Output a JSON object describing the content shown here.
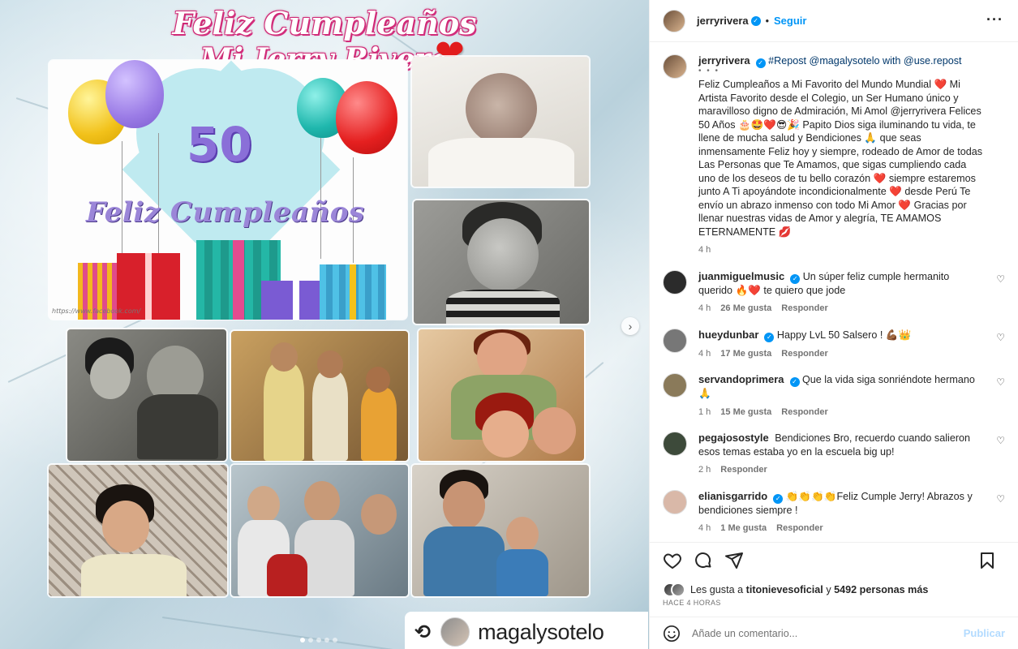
{
  "media": {
    "banner_line1": "Feliz Cumpleaños",
    "banner_line2": "Mi Jerry Rivera",
    "banner_heart": "❤",
    "card_number": "50",
    "card_greeting": "Feliz Cumpleaños",
    "repost_icon": "⟲",
    "repost_user": "magalysotelo",
    "next_arrow": "›"
  },
  "header": {
    "username": "jerryrivera",
    "verified": "✓",
    "dot": "•",
    "follow": "Seguir",
    "more": "···"
  },
  "caption": {
    "username": "jerryrivera",
    "repost_dots": "• • •",
    "prefix": "#Repost @magalysotelo with @use.repost",
    "text": "Feliz Cumpleaños a Mi Favorito del Mundo Mundial ❤️ Mi Artista Favorito desde el Colegio, un Ser Humano único y maravilloso digno de Admiración, Mi Amol @jerryrivera Felices 50 Años 🎂🤩❤️😎🎉 Papito Dios siga iluminando tu vida, te llene de mucha salud y Bendiciones 🙏 que seas inmensamente Feliz hoy y siempre, rodeado de Amor de todas Las Personas que Te Amamos, que sigas cumpliendo cada uno de los deseos de tu bello corazón ❤️ siempre estaremos junto A Ti apoyándote incondicionalmente ❤️ desde Perú Te envío un abrazo inmenso con todo Mi Amor ❤️ Gracias por llenar nuestras vidas de Amor y alegría, TE AMAMOS ETERNAMENTE 💋",
    "time": "4 h"
  },
  "comments": [
    {
      "username": "juanmiguelmusic",
      "verified": true,
      "text": "Un súper feliz cumple hermanito querido 🔥❤️ te quiero que jode",
      "time": "4 h",
      "likes": "26 Me gusta",
      "reply": "Responder",
      "avatar_color": "#2b2b2b"
    },
    {
      "username": "hueydunbar",
      "verified": true,
      "text": "Happy LvL 50 Salsero ! 💪🏾👑",
      "time": "4 h",
      "likes": "17 Me gusta",
      "reply": "Responder",
      "avatar_color": "#777777"
    },
    {
      "username": "servandoprimera",
      "verified": true,
      "text": "Que la vida siga sonriéndote hermano 🙏",
      "time": "1 h",
      "likes": "15 Me gusta",
      "reply": "Responder",
      "avatar_color": "#8a7a5a"
    },
    {
      "username": "pegajosostyle",
      "verified": false,
      "text": "Bendiciones Bro, recuerdo cuando salieron esos temas estaba yo en la escuela big up!",
      "time": "2 h",
      "likes": "",
      "reply": "Responder",
      "avatar_color": "#3d4a3a"
    },
    {
      "username": "elianisgarrido",
      "verified": true,
      "text": "👏👏👏👏Feliz Cumple Jerry! Abrazos y bendiciones siempre !",
      "time": "4 h",
      "likes": "1 Me gusta",
      "reply": "Responder",
      "avatar_color": "#d9b8a8"
    }
  ],
  "likes": {
    "prefix": "Les gusta a",
    "user": "titonievesoficial",
    "mid": "y",
    "count": "5492 personas más"
  },
  "timestamp": "HACE 4 HORAS",
  "comment_box": {
    "placeholder": "Añade un comentario...",
    "post": "Publicar"
  },
  "colors": {
    "link": "#0095f6",
    "mention": "#00376b",
    "muted": "#737373",
    "heart": "#e21c1c"
  },
  "icons": [
    "heart-icon",
    "comment-icon",
    "share-icon",
    "bookmark-icon",
    "emoji-icon",
    "repost-icon",
    "more-icon",
    "verified-icon"
  ]
}
